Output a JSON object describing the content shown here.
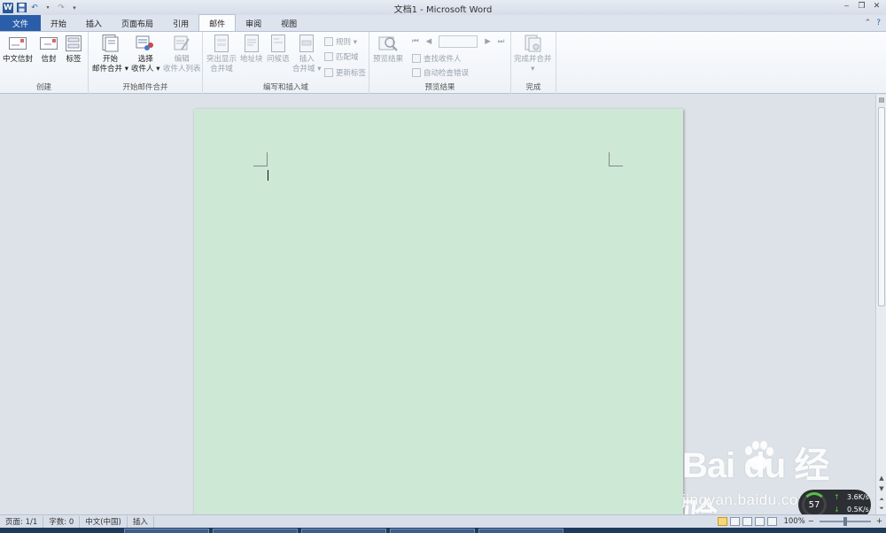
{
  "window": {
    "title": "文档1 - Microsoft Word",
    "app_icon": "word-icon"
  },
  "tabs": [
    {
      "label": "文件",
      "kind": "file"
    },
    {
      "label": "开始"
    },
    {
      "label": "插入"
    },
    {
      "label": "页面布局"
    },
    {
      "label": "引用"
    },
    {
      "label": "邮件",
      "active": true
    },
    {
      "label": "审阅"
    },
    {
      "label": "视图"
    }
  ],
  "ribbon": {
    "groups": {
      "create": {
        "label": "创建",
        "buttons": [
          {
            "label": "中文信封",
            "icon": "envelope-icon"
          },
          {
            "label": "信封",
            "icon": "envelope-icon"
          },
          {
            "label": "标签",
            "icon": "label-icon"
          }
        ]
      },
      "start_merge": {
        "label": "开始邮件合并",
        "buttons": [
          {
            "line1": "开始",
            "line2": "邮件合并 ▾",
            "icon": "mail-merge-icon"
          },
          {
            "line1": "选择",
            "line2": "收件人 ▾",
            "icon": "recipients-icon"
          },
          {
            "line1": "编辑",
            "line2": "收件人列表",
            "icon": "edit-list-icon",
            "disabled": true
          }
        ]
      },
      "write_insert": {
        "label": "编写和插入域",
        "buttons": [
          {
            "line1": "突出显示",
            "line2": "合并域",
            "icon": "highlight-fields-icon",
            "disabled": true
          },
          {
            "line1": "地址块",
            "line2": "",
            "icon": "address-block-icon",
            "disabled": true
          },
          {
            "line1": "问候语",
            "line2": "",
            "icon": "greeting-line-icon",
            "disabled": true
          },
          {
            "line1": "插入",
            "line2": "合并域 ▾",
            "icon": "insert-field-icon",
            "disabled": true
          }
        ],
        "small": [
          {
            "label": "规则 ▾",
            "icon": "rules-icon"
          },
          {
            "label": "匹配域",
            "icon": "match-fields-icon"
          },
          {
            "label": "更新标签",
            "icon": "update-labels-icon"
          }
        ]
      },
      "preview": {
        "label": "预览结果",
        "button": {
          "label": "预览结果",
          "icon": "preview-icon"
        },
        "small": [
          {
            "label": "查找收件人",
            "icon": "find-recipient-icon"
          },
          {
            "label": "自动检查错误",
            "icon": "check-errors-icon"
          }
        ],
        "record_value": ""
      },
      "finish": {
        "label": "完成",
        "button": {
          "line1": "完成并合并",
          "line2": "▾",
          "icon": "finish-merge-icon"
        }
      }
    }
  },
  "statusbar": {
    "page": "页面: 1/1",
    "words": "字数: 0",
    "language": "中文(中国)",
    "mode": "插入",
    "zoom": "100%",
    "minus": "−",
    "plus": "+"
  },
  "watermark": {
    "main": "Bai  du 经验",
    "sub": "jingyan.baidu.com"
  },
  "speed_widget": {
    "percent": "57",
    "upload": "3.6K/s",
    "download": "0.5K/s"
  },
  "colors": {
    "page_bg": "#cde8d4",
    "file_tab": "#2a5ea8",
    "ribbon_bg": "#fbfcfe"
  }
}
